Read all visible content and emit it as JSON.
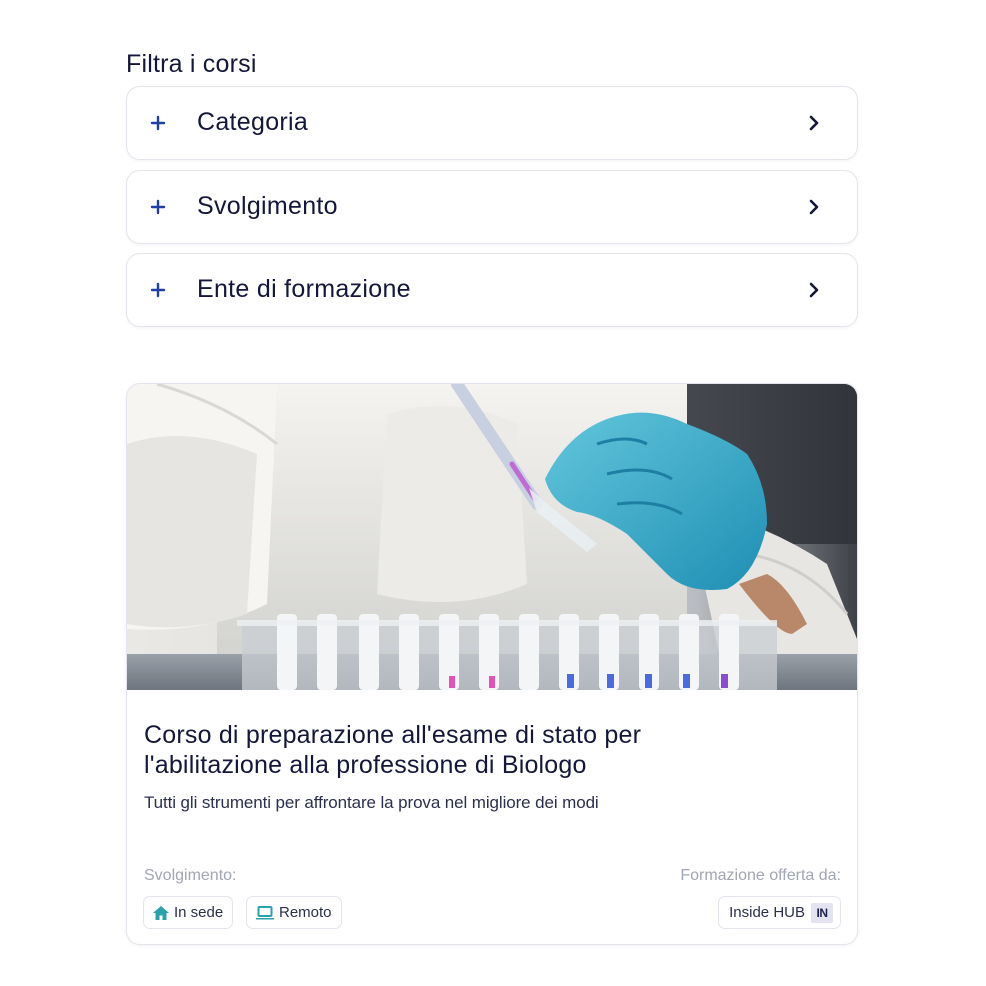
{
  "filters": {
    "title": "Filtra i corsi",
    "items": [
      {
        "label": "Categoria"
      },
      {
        "label": "Svolgimento"
      },
      {
        "label": "Ente di formazione"
      }
    ]
  },
  "course_card": {
    "image_alt": "Laboratory technician pipetting samples into test tubes",
    "title_line1": "Corso di preparazione all'esame di stato per",
    "title_line2": "l'abilitazione alla professione di Biologo",
    "subtitle": "Tutti gli strumenti per affrontare la prova nel migliore dei modi",
    "delivery_label": "Svolgimento:",
    "delivery_tags": [
      {
        "label": "In sede",
        "icon": "home-icon"
      },
      {
        "label": "Remoto",
        "icon": "laptop-icon"
      }
    ],
    "provider_label": "Formazione offerta da:",
    "provider_name": "Inside HUB",
    "provider_logo_text": "IN"
  },
  "colors": {
    "accent": "#1f3fa6",
    "icon_teal": "#2aa3a8",
    "text_dark": "#14163a",
    "text_muted": "#a2a5b4",
    "border": "#e3e5ec"
  }
}
